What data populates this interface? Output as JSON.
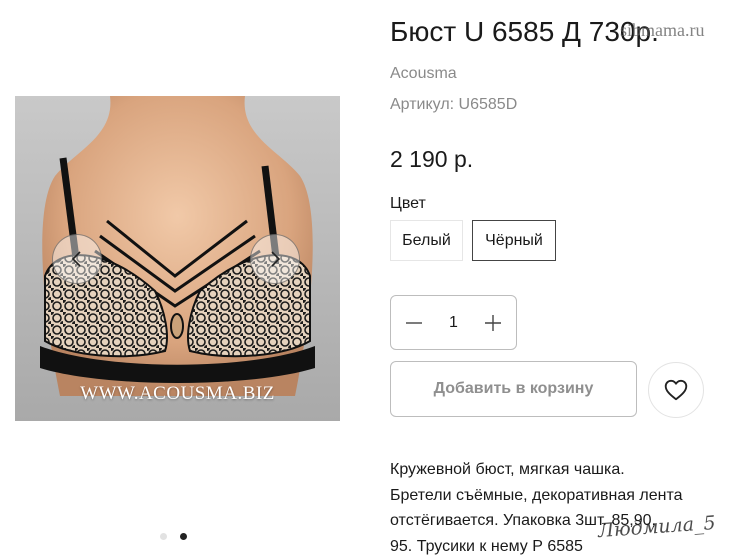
{
  "product": {
    "title": "Бюст U 6585 Д 730р.",
    "brand": "Acousma",
    "sku": "Артикул: U6585D",
    "price": "2 190 р.",
    "color_label": "Цвет",
    "colors": [
      "Белый",
      "Чёрный"
    ],
    "selected_color": "Чёрный",
    "quantity": "1",
    "add_to_cart_label": "Добавить в корзину",
    "description_lines": [
      "Кружевной бюст, мягкая чашка.",
      "Бретели съёмные, декоративная лента",
      "отстёгивается. Упаковка 3шт. 85,90,",
      "95. Трусики к нему Р 6585"
    ]
  },
  "gallery": {
    "photo_watermark": "WWW.ACOUSMA.BIZ",
    "slide_count": 2,
    "active_slide": 2
  },
  "watermarks": {
    "site": "sibmama.ru",
    "signature": "Людмила_5"
  },
  "icons": {
    "prev": "chevron-left-icon",
    "next": "chevron-right-icon",
    "minus": "minus-icon",
    "plus": "plus-icon",
    "favorite": "heart-icon"
  },
  "colors": {
    "photo_background": "#bdbdbd",
    "secondary_text": "#8a8a8a",
    "border": "#bdbdbd"
  }
}
